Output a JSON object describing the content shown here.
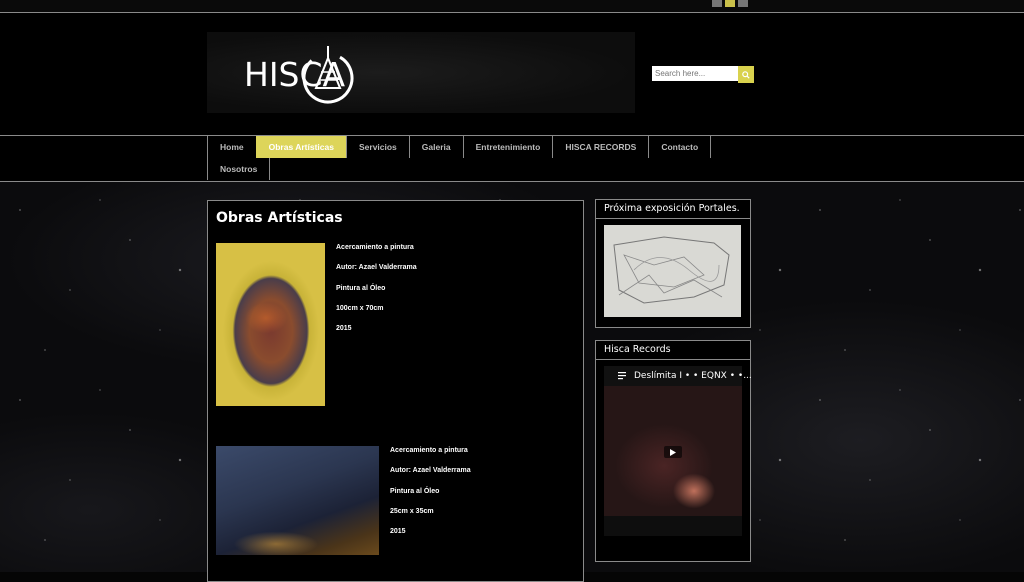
{
  "brand": {
    "logo_text": "HISCA"
  },
  "search": {
    "placeholder": "Search here..."
  },
  "nav": {
    "items": [
      "Home",
      "Obras Artísticas",
      "Servicios",
      "Galeria",
      "Entretenimiento",
      "HISCA RECORDS",
      "Contacto",
      "Nosotros"
    ],
    "active": "Obras Artísticas"
  },
  "main": {
    "title": "Obras Artísticas",
    "artworks": [
      {
        "lines": [
          "Acercamiento a pintura",
          "Autor: Azael Valderrama",
          "Pintura al Óleo",
          "100cm x 70cm",
          "2015"
        ]
      },
      {
        "lines": [
          "Acercamiento a pintura",
          "Autor: Azael Valderrama",
          "Pintura al Óleo",
          "25cm x 35cm",
          "2015"
        ]
      }
    ]
  },
  "sidebar": {
    "widget1_title": "Próxima exposición Portales.",
    "widget2_title": "Hisca Records",
    "video_title": "Deslímita I • • EQNX • •..."
  },
  "colors": {
    "accent": "#ddd55a",
    "border": "#8a8a8a",
    "background": "#000000"
  }
}
